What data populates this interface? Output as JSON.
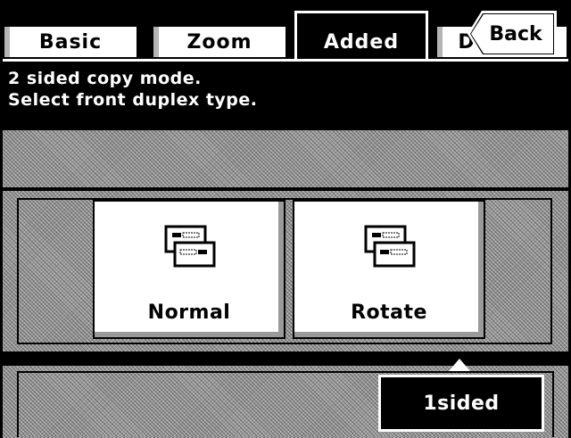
{
  "tabs": [
    {
      "label": "Basic"
    },
    {
      "label": "Zoom"
    },
    {
      "label": "Added"
    },
    {
      "label": "Default"
    }
  ],
  "header": {
    "line1": "2 sided copy mode.",
    "line2": "Select front duplex type.",
    "back_label": "Back"
  },
  "options": {
    "normal_label": "Normal",
    "rotate_label": "Rotate"
  },
  "footer": {
    "sided_label": "1sided"
  },
  "icons": {
    "normal": "duplex-normal-icon",
    "rotate": "duplex-rotate-icon"
  },
  "colors": {
    "background": "#000000",
    "button": "#ffffff",
    "pattern_gray": "#9a9a9a"
  }
}
